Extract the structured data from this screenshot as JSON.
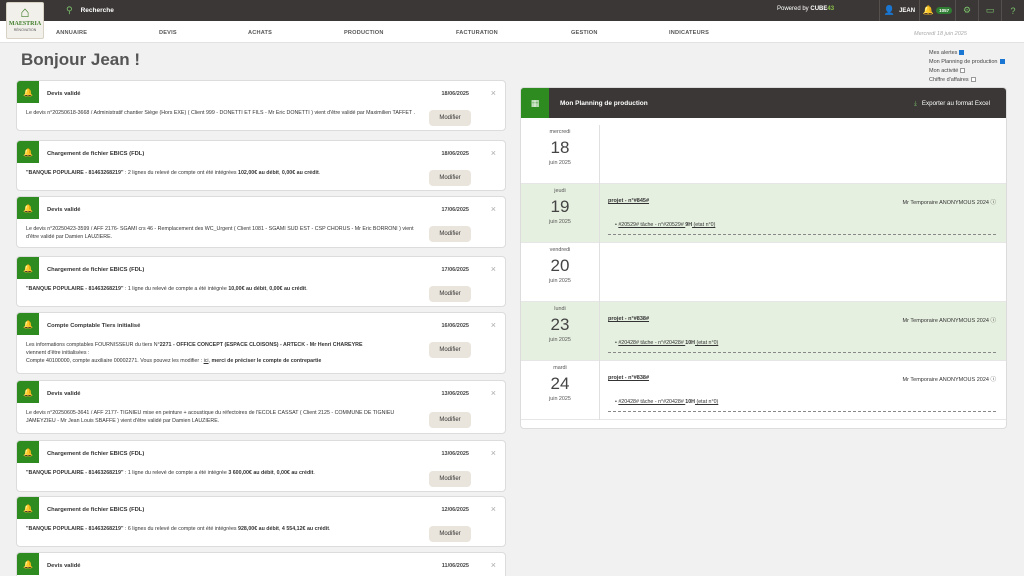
{
  "logo": {
    "line1": "MAESTRIA",
    "line2": "RÉNOVATION"
  },
  "topbar": {
    "search_label": "Recherche",
    "powered_prefix": "Powered by ",
    "powered_brand": "CUBE",
    "powered_num": "43",
    "user": "JEAN",
    "notif_count": "1057"
  },
  "nav": {
    "items": [
      "ANNUAIRE",
      "DEVIS",
      "ACHATS",
      "PRODUCTION",
      "FACTURATION",
      "GESTION",
      "INDICATEURS"
    ],
    "date": "Mercredi 18 juin 2025"
  },
  "greeting": "Bonjour Jean !",
  "options": [
    {
      "label": "Mes alertes",
      "checked": true
    },
    {
      "label": "Mon Planning de production",
      "checked": true
    },
    {
      "label": "Mon activité",
      "checked": false
    },
    {
      "label": "Chiffre d'affaires",
      "checked": false
    }
  ],
  "cards": [
    {
      "title": "Devis validé",
      "date": "18/06/2025",
      "body": "Le devis n°20250618-3668 / Administratif chantier Siège (Hors EXE) ( Client 999 - DONETTI ET FILS - Mr Eric DONETTI ) vient d'être validé par Maximilien TAFFET .",
      "btn": "Modifier"
    },
    {
      "title": "Chargement de fichier EBICS (FDL)",
      "date": "18/06/2025",
      "body_a": "\"BANQUE POPULAIRE - 81463268219\"",
      "body_b": " : 2 lignes du relevé de compte ont été intégrées ",
      "body_c": "102,00€ au débit",
      "body_d": ", ",
      "body_e": "0,00€ au crédit",
      "body_f": ".",
      "btn": "Modifier"
    },
    {
      "title": "Devis validé",
      "date": "17/06/2025",
      "body": "Le devis n°20250423-3599 / AFF 2176- SGAMI crs 46 - Remplacement des WC_Urgent ( Client 1081 - SGAMI SUD EST - CSP CHORUS - Mr Eric BORRONI ) vient d'être validé par Damien LAUZIERE.",
      "btn": "Modifier"
    },
    {
      "title": "Chargement de fichier EBICS (FDL)",
      "date": "17/06/2025",
      "body_a": "\"BANQUE POPULAIRE - 81463268219\"",
      "body_b": " : 1 ligne du relevé de compte a été intégrée ",
      "body_c": "10,00€ au débit",
      "body_d": ", ",
      "body_e": "0,00€ au crédit",
      "body_f": ".",
      "btn": "Modifier"
    },
    {
      "title": "Compte Comptable Tiers initialisé",
      "date": "16/06/2025",
      "l1a": "Les informations comptables FOURNISSEUR du tiers N°",
      "l1b": "2271 - OFFICE CONCEPT (ESPACE CLOISONS) - ARTECK - Mr Henri CHAREYRE",
      "l2": "viennent d'être initialisées :",
      "l3a": "Compte 40100000, compte auxiliaire 00002271. Vous pouvez les modifier : ",
      "l3b": "ici",
      "l3c": ", ",
      "l3d": "merci de préciser le compte de contrepartie",
      "btn": "Modifier"
    },
    {
      "title": "Devis validé",
      "date": "13/06/2025",
      "body": "Le devis n°20250605-3641 / AFF 2177- TIGNIEU mise en peinture + acoustique du réfectoires de l'ECOLE CASSAT ( Client 2125 - COMMUNE DE TIGNIEU JAMEYZIEU - Mr Jean Louis SBAFFE ) vient d'être validé par Damien LAUZIERE.",
      "btn": "Modifier"
    },
    {
      "title": "Chargement de fichier EBICS (FDL)",
      "date": "13/06/2025",
      "body_a": "\"BANQUE POPULAIRE - 81463268219\"",
      "body_b": " : 1 ligne du relevé de compte a été intégrée ",
      "body_c": "3 600,00€ au débit",
      "body_d": ", ",
      "body_e": "0,00€ au crédit",
      "body_f": ".",
      "btn": "Modifier"
    },
    {
      "title": "Chargement de fichier EBICS (FDL)",
      "date": "12/06/2025",
      "body_a": "\"BANQUE POPULAIRE - 81463268219\"",
      "body_b": " : 6 lignes du relevé de compte ont été intégrées ",
      "body_c": "928,00€ au débit",
      "body_d": ", ",
      "body_e": "4 554,12€ au crédit",
      "body_f": ".",
      "btn": "Modifier"
    },
    {
      "title": "Devis validé",
      "date": "11/06/2025"
    }
  ],
  "planning": {
    "title": "Mon Planning de production",
    "export": "Exporter au format Excel",
    "days": [
      {
        "weekday": "mercredi",
        "num": "18",
        "month": "juin 2025"
      },
      {
        "weekday": "jeudi",
        "num": "19",
        "month": "juin 2025",
        "project": "projet - n°#845#",
        "owner": "Mr Temporaire ANONYMOUS 2024",
        "task_a": "#20529# tâche - n°#20529# ",
        "task_b": "9H",
        "task_c": " (etat n°0)"
      },
      {
        "weekday": "vendredi",
        "num": "20",
        "month": "juin 2025"
      },
      {
        "weekday": "lundi",
        "num": "23",
        "month": "juin 2025",
        "project": "projet - n°#838#",
        "owner": "Mr Temporaire ANONYMOUS 2024",
        "task_a": "#20428# tâche - n°#20428# ",
        "task_b": "10H",
        "task_c": " (etat n°0)"
      },
      {
        "weekday": "mardi",
        "num": "24",
        "month": "juin 2025",
        "project": "projet - n°#838#",
        "owner": "Mr Temporaire ANONYMOUS 2024",
        "task_a": "#20428# tâche - n°#20428# ",
        "task_b": "10H",
        "task_c": " (etat n°0)"
      }
    ]
  }
}
